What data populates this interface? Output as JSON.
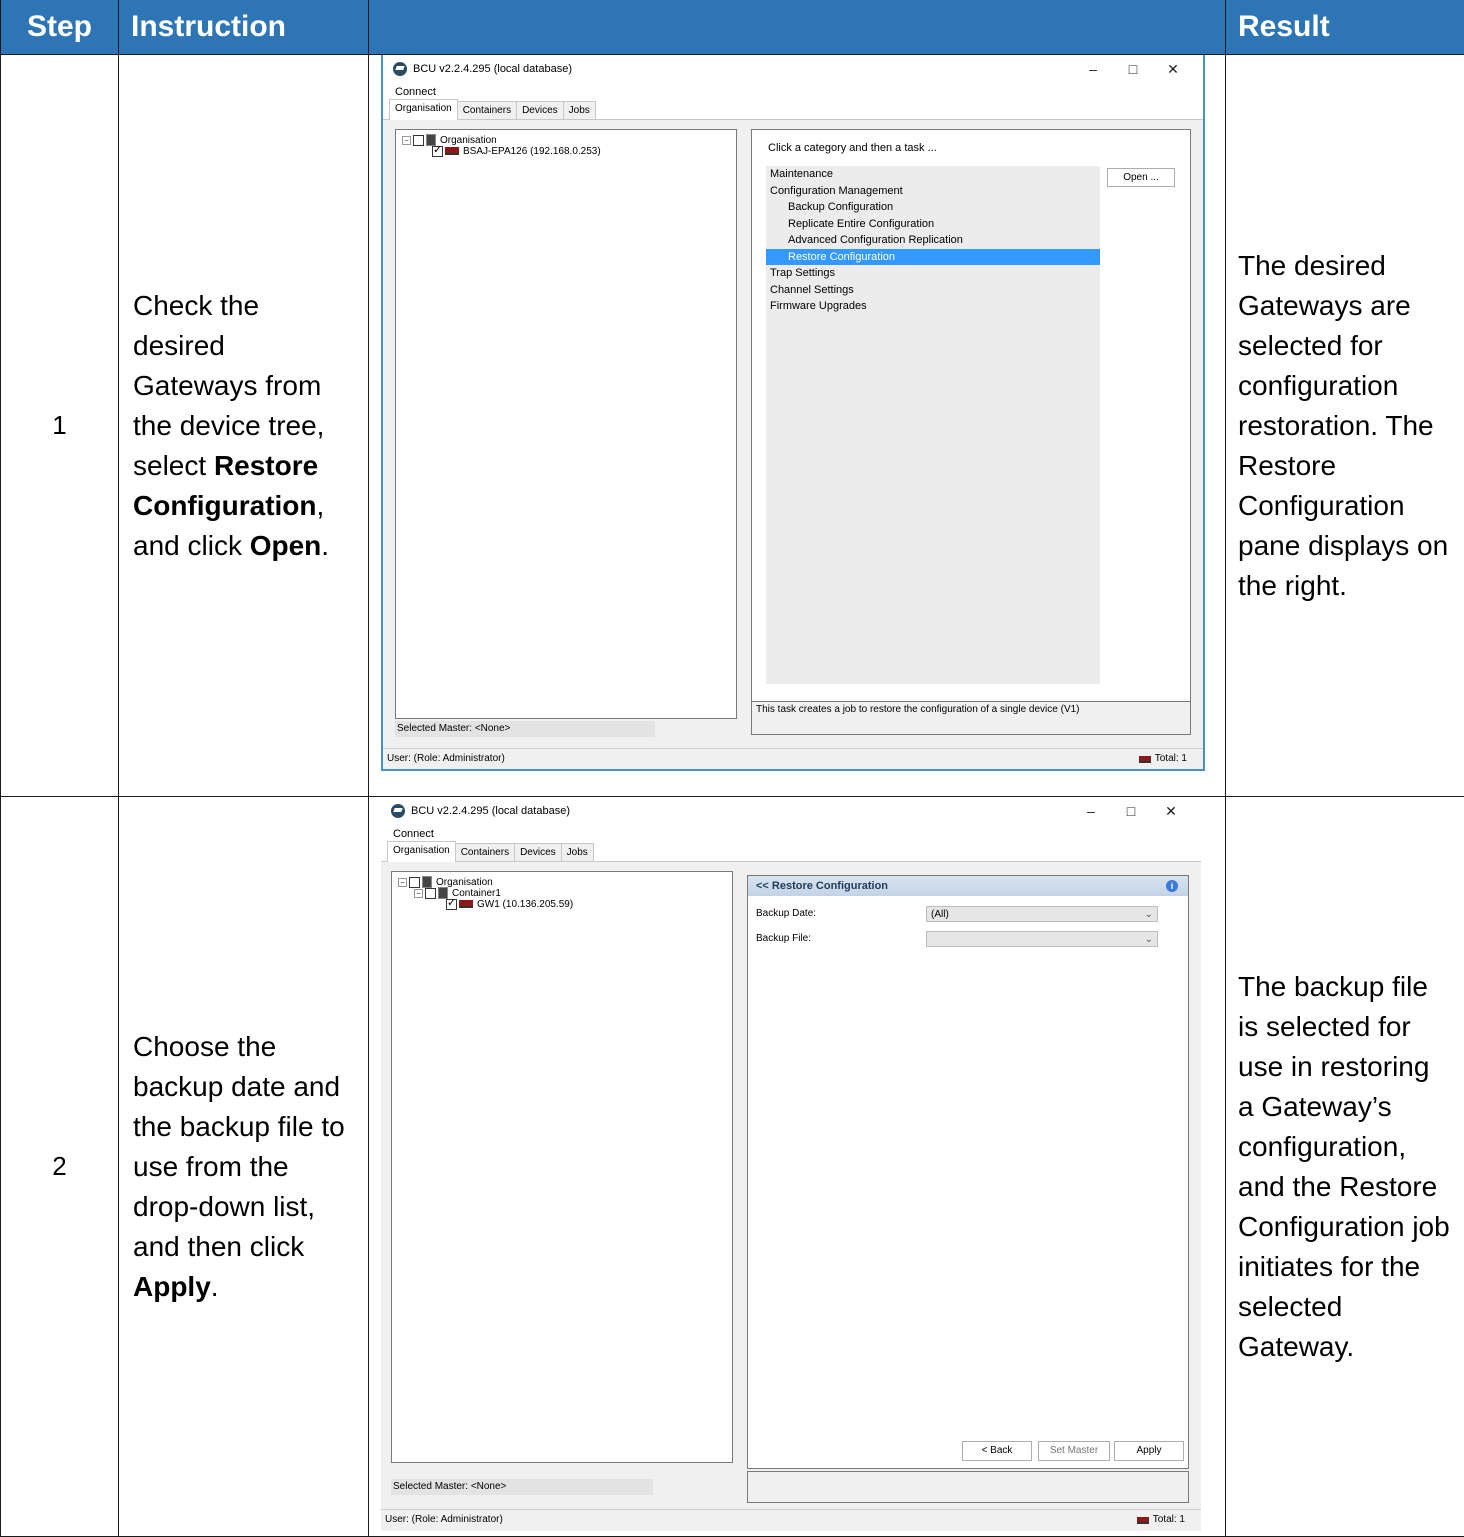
{
  "header": {
    "step": "Step",
    "instruction": "Instruction",
    "result": "Result"
  },
  "rows": [
    {
      "step": "1",
      "instruction": {
        "t1": "Check the desired Gateways from the device tree, select ",
        "b1": "Restore Configuration",
        "t2": ", and click ",
        "b2": "Open",
        "t3": "."
      },
      "result": "The desired Gateways are selected for configuration restoration. The Restore Configuration pane displays on the right."
    },
    {
      "step": "2",
      "instruction": {
        "t1": "Choose the backup date and the backup file to use from the drop-down list, and then click ",
        "b1": "Apply",
        "t2": "."
      },
      "result": "The backup file is selected for use in restoring a Gateway’s configuration, and the Restore Configuration job initiates for the selected Gateway."
    }
  ],
  "app": {
    "title": "BCU v2.2.4.295 (local database)",
    "menu": "Connect",
    "tabs": [
      "Organisation",
      "Containers",
      "Devices",
      "Jobs"
    ],
    "win_controls": {
      "minimize": "–",
      "maximize": "□",
      "close": "✕"
    },
    "selected_master": "Selected Master: <None>",
    "status_user": "User:  (Role: Administrator)",
    "status_total": "Total: 1"
  },
  "shot1": {
    "tree": [
      "Organisation",
      "BSAJ-EPA126 (192.168.0.253)"
    ],
    "prompt": "Click a category and then a task ...",
    "tasks": [
      {
        "label": "Maintenance",
        "sub": false,
        "selected": false
      },
      {
        "label": "Configuration Management",
        "sub": false,
        "selected": false
      },
      {
        "label": "Backup Configuration",
        "sub": true,
        "selected": false
      },
      {
        "label": "Replicate Entire Configuration",
        "sub": true,
        "selected": false
      },
      {
        "label": "Advanced Configuration Replication",
        "sub": true,
        "selected": false
      },
      {
        "label": "Restore Configuration",
        "sub": true,
        "selected": true
      },
      {
        "label": "Trap Settings",
        "sub": false,
        "selected": false
      },
      {
        "label": "Channel Settings",
        "sub": false,
        "selected": false
      },
      {
        "label": "Firmware Upgrades",
        "sub": false,
        "selected": false
      }
    ],
    "open_button": "Open ...",
    "description": "This task creates a job to restore the configuration of a single device (V1)"
  },
  "shot2": {
    "tree": [
      "Organisation",
      "Container1",
      "GW1 (10.136.205.59)"
    ],
    "pane_title": "<< Restore Configuration",
    "backup_date_label": "Backup Date:",
    "backup_date_value": "(All)",
    "backup_file_label": "Backup File:",
    "backup_file_value": "",
    "back_button": "< Back",
    "set_master_button": "Set Master",
    "apply_button": "Apply"
  }
}
